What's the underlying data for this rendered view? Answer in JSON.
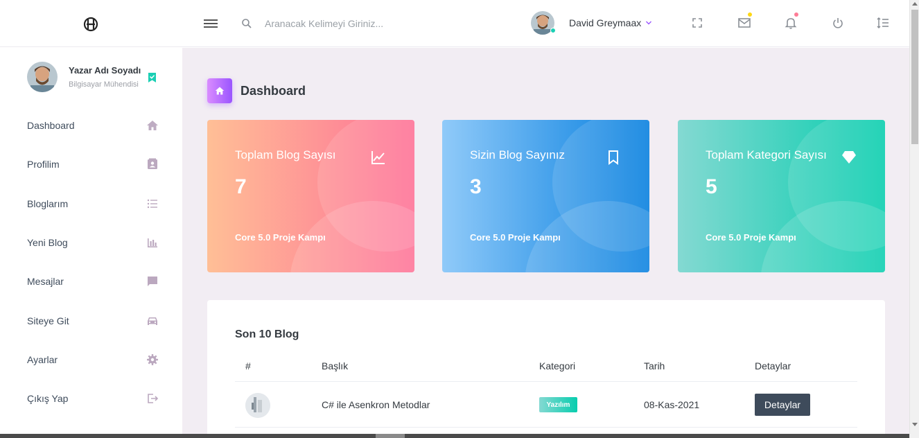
{
  "header": {
    "search_placeholder": "Aranacak Kelimeyi Giriniz...",
    "user_name": "David Greymaax",
    "icons": [
      "fullscreen-icon",
      "mail-icon",
      "bell-icon",
      "power-icon",
      "format-line-spacing-icon"
    ],
    "mail_badge_color": "#fed713",
    "bell_badge_color": "#fe7c96"
  },
  "sidebar": {
    "profile": {
      "name": "Yazar Adı Soyadı",
      "title": "Bilgisayar Mühendisi"
    },
    "items": [
      {
        "label": "Dashboard",
        "icon": "home-icon"
      },
      {
        "label": "Profilim",
        "icon": "contacts-icon"
      },
      {
        "label": "Bloglarım",
        "icon": "format-list-bulleted-icon"
      },
      {
        "label": "Yeni Blog",
        "icon": "chart-bar-icon"
      },
      {
        "label": "Mesajlar",
        "icon": "message-icon"
      },
      {
        "label": "Siteye Git",
        "icon": "car-icon"
      },
      {
        "label": "Ayarlar",
        "icon": "settings-icon"
      },
      {
        "label": "Çıkış Yap",
        "icon": "logout-icon"
      }
    ]
  },
  "page": {
    "title": "Dashboard"
  },
  "cards": [
    {
      "title": "Toplam Blog Sayısı",
      "value": "7",
      "footer": "Core 5.0 Proje Kampı",
      "icon": "chart-line-icon",
      "gradient": [
        "#ffbf96",
        "#fe7096"
      ]
    },
    {
      "title": "Sizin Blog Sayınız",
      "value": "3",
      "footer": "Core 5.0 Proje Kampı",
      "icon": "bookmark-icon",
      "gradient": [
        "#90caf9",
        "#047edf"
      ]
    },
    {
      "title": "Toplam Kategori Sayısı",
      "value": "5",
      "footer": "Core 5.0 Proje Kampı",
      "icon": "diamond-icon",
      "gradient": [
        "#84d9d2",
        "#07cdae"
      ]
    }
  ],
  "table": {
    "title": "Son 10 Blog",
    "headers": [
      "#",
      "Başlık",
      "Kategori",
      "Tarih",
      "Detaylar"
    ],
    "rows": [
      {
        "title": "C# ile Asenkron Metodlar",
        "category": "Yazılım",
        "date": "08-Kas-2021",
        "button": "Detaylar"
      }
    ]
  }
}
